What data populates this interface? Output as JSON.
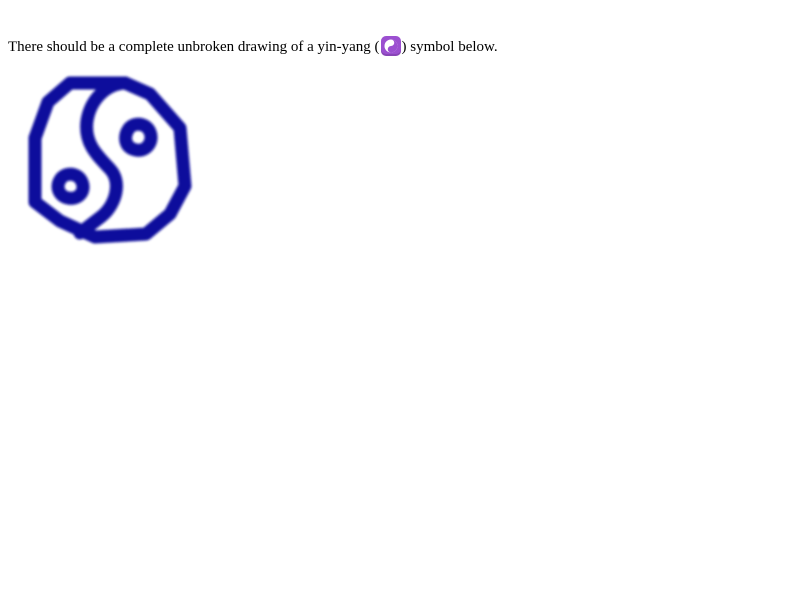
{
  "intro": {
    "text_before": "There should be a complete unbroken drawing of a yin-yang (",
    "text_after": ") symbol below."
  },
  "icons": {
    "inline": "yin-yang-emoji-icon",
    "drawing": "yin-yang-drawing-icon"
  },
  "colors": {
    "background": "#ffffff",
    "text": "#000000",
    "stroke": "#0e0e9c",
    "emoji_badge": "#9b4fd0"
  }
}
